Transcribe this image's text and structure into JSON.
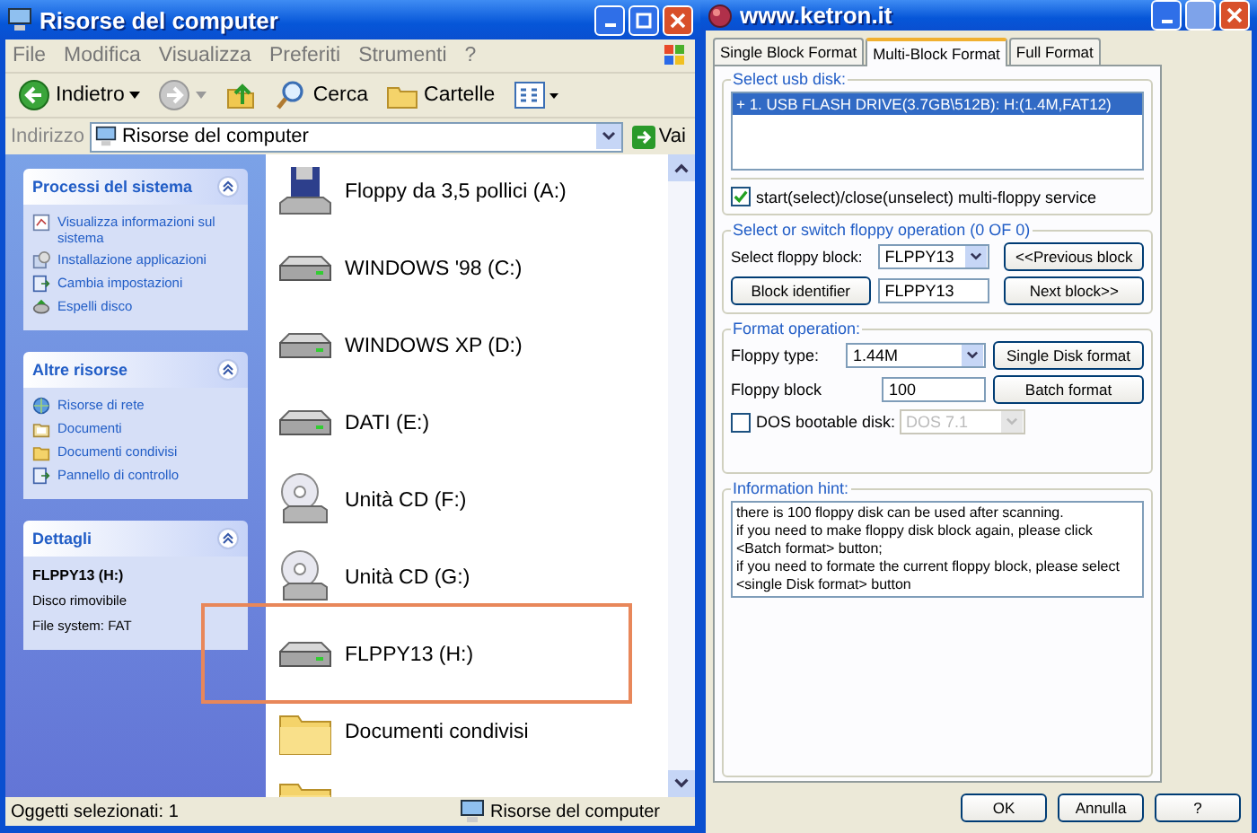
{
  "explorer": {
    "title": "Risorse del computer",
    "menu": [
      "File",
      "Modifica",
      "Visualizza",
      "Preferiti",
      "Strumenti",
      "?"
    ],
    "toolbar": [
      {
        "kind": "back",
        "label": "Indietro"
      },
      {
        "kind": "forward"
      },
      {
        "kind": "up"
      },
      {
        "kind": "search",
        "label": "Cerca"
      },
      {
        "kind": "folders",
        "label": "Cartelle"
      },
      {
        "kind": "views"
      }
    ],
    "address": {
      "label": "Indirizzo",
      "value": "Risorse del computer",
      "go": "Vai"
    },
    "panels": [
      {
        "title": "Processi del sistema",
        "expanded": true,
        "links": [
          {
            "kind": "info",
            "label": "Visualizza informazioni sul sistema"
          },
          {
            "kind": "install",
            "label": "Installazione applicazioni"
          },
          {
            "kind": "settings",
            "label": "Cambia impostazioni"
          },
          {
            "kind": "eject",
            "label": "Espelli disco"
          }
        ]
      },
      {
        "title": "Altre risorse",
        "expanded": true,
        "links": [
          {
            "kind": "network",
            "label": "Risorse di rete"
          },
          {
            "kind": "docs",
            "label": "Documenti"
          },
          {
            "kind": "folder",
            "label": "Documenti condivisi"
          },
          {
            "kind": "settings",
            "label": "Pannello di controllo"
          }
        ]
      },
      {
        "title": "Dettagli",
        "expanded": true,
        "details": [
          "FLPPY13 (H:)",
          "Disco rimovibile",
          "File system: FAT"
        ]
      }
    ],
    "items": [
      {
        "kind": "floppy",
        "label": "Floppy da 3,5 pollici (A:)"
      },
      {
        "kind": "drive",
        "label": "WINDOWS '98 (C:)"
      },
      {
        "kind": "drive",
        "label": "WINDOWS XP (D:)"
      },
      {
        "kind": "drive",
        "label": "DATI (E:)"
      },
      {
        "kind": "cd",
        "label": "Unità CD (F:)"
      },
      {
        "kind": "cd",
        "label": "Unità CD (G:)"
      },
      {
        "kind": "drive",
        "label": "FLPPY13 (H:)",
        "highlighted": true
      },
      {
        "kind": "folder",
        "label": "Documenti condivisi"
      },
      {
        "kind": "folder_partial"
      }
    ],
    "status": [
      "Oggetti selezionati: 1",
      "Risorse del computer"
    ]
  },
  "tool": {
    "title": "www.ketron.it",
    "tabs": [
      {
        "label": "Single Block Format",
        "selected": false
      },
      {
        "label": "Multi-Block Format",
        "selected": true
      },
      {
        "label": "Full Format",
        "selected": false
      }
    ],
    "usb": {
      "legend": "Select usb disk:",
      "rows": [
        {
          "label": "+ 1. USB FLASH DRIVE(3.7GB\\512B): H:(1.4M,FAT12)",
          "selected": true
        }
      ],
      "service": {
        "label": "start(select)/close(unselect) multi-floppy service",
        "checked": true
      }
    },
    "switch": {
      "legend": "Select or switch floppy operation (0 OF 0)",
      "block_label": "Select floppy block:",
      "block_value": "FLPPY13",
      "prev": "<<Previous block",
      "identifier": "Block identifier",
      "identifier_value": "FLPPY13",
      "next": "Next block>>"
    },
    "format": {
      "legend": "Format operation:",
      "type_label": "Floppy type:",
      "type_value": "1.44M",
      "single": "Single Disk format",
      "block_label": "Floppy block",
      "block_value": "100",
      "batch": "Batch format",
      "dos": {
        "label": "DOS bootable disk:",
        "checked": false,
        "value": "DOS 7.1",
        "disabled": true
      }
    },
    "hint": {
      "legend": "Information hint:",
      "text": "there is 100 floppy disk can be used after scanning.\nif you need to make floppy disk block again, please click\n<Batch format> button;\nif you need to formate the current floppy block, please select\n<single Disk format> button"
    },
    "buttons": [
      "OK",
      "Annulla",
      "?"
    ]
  }
}
